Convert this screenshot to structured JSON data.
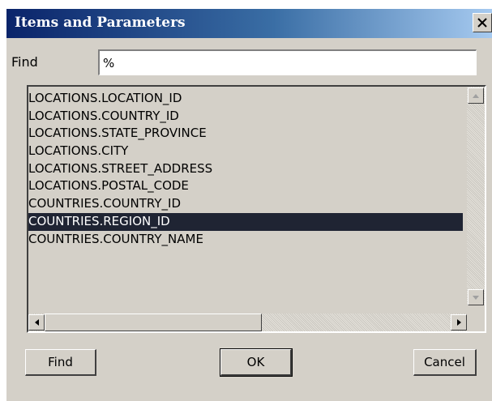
{
  "window": {
    "title": "Items and Parameters",
    "close_icon": "close-icon"
  },
  "find": {
    "label": "Find",
    "value": "%"
  },
  "list": {
    "items": [
      "LOCATIONS.LOCATION_ID",
      "LOCATIONS.COUNTRY_ID",
      "LOCATIONS.STATE_PROVINCE",
      "LOCATIONS.CITY",
      "LOCATIONS.STREET_ADDRESS",
      "LOCATIONS.POSTAL_CODE",
      "COUNTRIES.COUNTRY_ID",
      "COUNTRIES.REGION_ID",
      "COUNTRIES.COUNTRY_NAME"
    ],
    "selected_index": 7
  },
  "buttons": {
    "find": "Find",
    "ok": "OK",
    "cancel": "Cancel"
  },
  "colors": {
    "selection": "#1f2433",
    "title_start": "#0a246a",
    "face": "#d4d0c8"
  }
}
